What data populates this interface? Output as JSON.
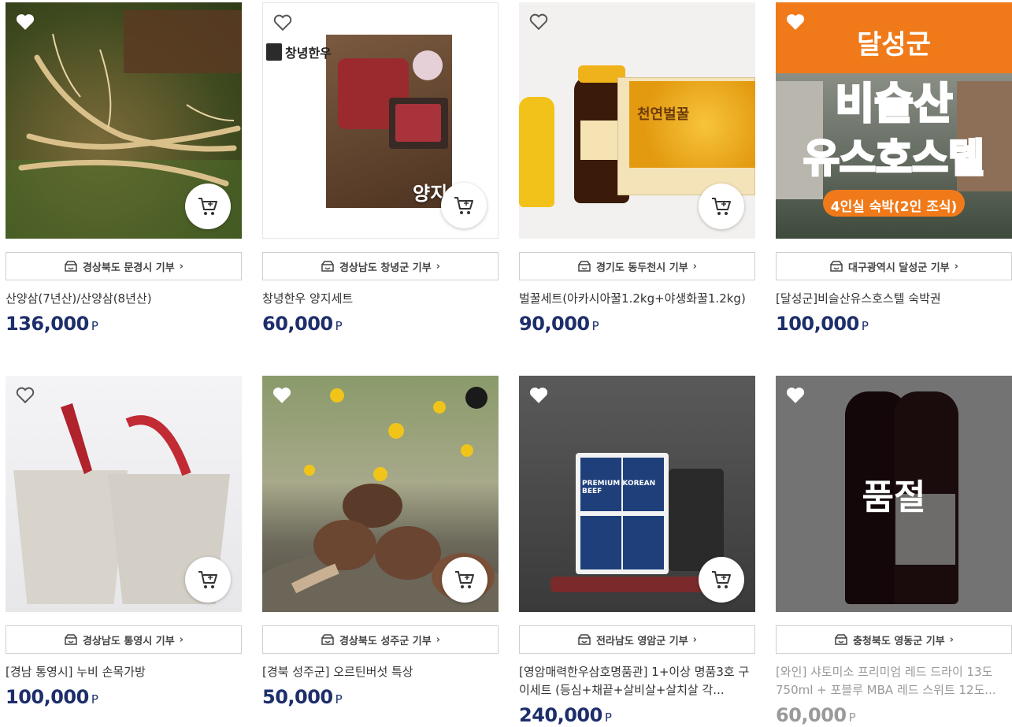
{
  "products": [
    {
      "region": "경상북도 문경시 기부",
      "name": "산양삼(7년산)/산양삼(8년산)",
      "price": "136,000",
      "unit": "P",
      "image": "wild-ginseng-photo"
    },
    {
      "region": "경상남도 창녕군 기부",
      "name": "창녕한우 양지세트",
      "price": "60,000",
      "unit": "P",
      "image": "hanwoo-beef-photo",
      "image_text": {
        "brand": "창녕한우",
        "caption": "양지"
      }
    },
    {
      "region": "경기도 동두천시 기부",
      "name": "벌꿀세트(아카시아꿀1.2kg+야생화꿀1.2kg)",
      "price": "90,000",
      "unit": "P",
      "image": "honey-set-photo",
      "image_text": {
        "box": "천연벌꿀"
      }
    },
    {
      "region": "대구광역시 달성군 기부",
      "name": "[달성군]비슬산유스호스텔 숙박권",
      "price": "100,000",
      "unit": "P",
      "image": "youth-hostel-banner",
      "image_text": {
        "line1": "달성군",
        "line2": "비슬산",
        "line3": "유스호스텔",
        "line4": "4인실 숙박(2인 조식)"
      }
    },
    {
      "region": "경상남도 통영시 기부",
      "name": "[경남 통영시] 누비 손목가방",
      "price": "100,000",
      "unit": "P",
      "image": "quilted-bags-photo"
    },
    {
      "region": "경상북도 성주군 기부",
      "name": "[경북 성주군] 오르틴버섯 특상",
      "price": "50,000",
      "unit": "P",
      "image": "mushroom-photo"
    },
    {
      "region": "전라남도 영암군 기부",
      "name": "[영암매력한우삼호명품관] 1+이상 명품3호 구이세트 (등심+채끝+살비살+살치살 각...",
      "price": "240,000",
      "unit": "P",
      "image": "premium-beef-set-photo",
      "image_text": {
        "label": "PREMIUM KOREAN BEEF"
      }
    },
    {
      "region": "충청북도 영동군 기부",
      "name": "[와인] 샤토미소 프리미엄 레드 드라이 13도 750ml + 포블루 MBA 레드 스위트 12도...",
      "price": "60,000",
      "unit": "P",
      "image": "wine-bottles-photo",
      "soldout": "품절"
    }
  ],
  "colors": {
    "price": "#1d2e6b",
    "muted": "#9a9a9a",
    "hostel_orange": "#f07a1a"
  }
}
